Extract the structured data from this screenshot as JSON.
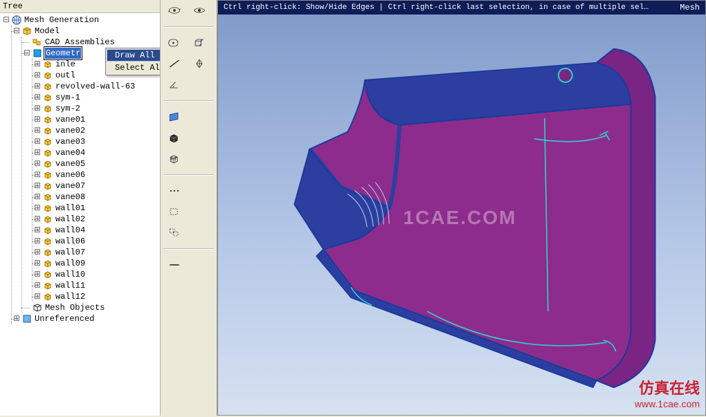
{
  "panel": {
    "title": "Tree"
  },
  "tree": {
    "root": "Mesh Generation",
    "model": "Model",
    "cad": "CAD Assemblies",
    "geo": "Geometr",
    "items": [
      "inle",
      "outl",
      "revolved-wall-63",
      "sym-1",
      "sym-2",
      "vane01",
      "vane02",
      "vane03",
      "vane04",
      "vane05",
      "vane06",
      "vane07",
      "vane08",
      "wall01",
      "wall02",
      "wall04",
      "wall06",
      "wall07",
      "wall09",
      "wall10",
      "wall11",
      "wall12"
    ],
    "meshobj": "Mesh Objects",
    "unref": "Unreferenced"
  },
  "context_menu": {
    "items": [
      "Draw All",
      "Select All"
    ],
    "highlighted_index": 0
  },
  "viewport": {
    "header_right": "Mesh",
    "hint": "Ctrl right-click: Show/Hide Edges | Ctrl right-click last selection, in case of multiple selections | Ctrl h: Hotkey Help",
    "watermark_center": "1CAE.COM",
    "watermark_corner_cn": "仿真在线",
    "watermark_corner_url": "www.1cae.com"
  },
  "tools": {
    "row1": [
      "orbit-icon",
      "eye-icon"
    ],
    "row2": [
      "point-icon",
      "body-icon"
    ],
    "row3": [
      "edge-icon",
      "crosshair-icon"
    ],
    "row4": [
      "angle-icon"
    ],
    "row5": [
      "surface-icon"
    ],
    "row6": [
      "volume-icon"
    ],
    "row7": [
      "mesh-icon"
    ],
    "row8": [
      "nodes-icon"
    ],
    "row9": [
      "select-mode-icon"
    ],
    "row10": [
      "unused-icon"
    ]
  },
  "colors": {
    "accent": "#316ac5",
    "part_fill": "#8d2c8c",
    "part_edge": "#1a3b9b",
    "part_hilite": "#30d0d0"
  }
}
